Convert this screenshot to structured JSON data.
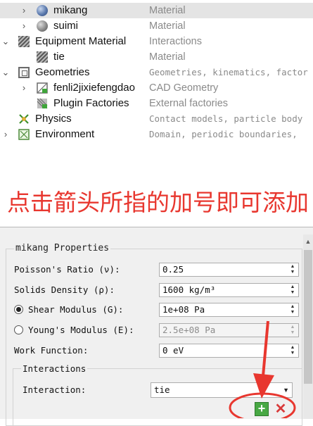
{
  "tree": {
    "items": [
      {
        "label": "mikang",
        "description": "Material",
        "icon": "material-ball-icon"
      },
      {
        "label": "suimi",
        "description": "Material",
        "icon": "material-ball-icon"
      },
      {
        "label": "Equipment Material",
        "description": "Interactions",
        "icon": "hatch-icon"
      },
      {
        "label": "tie",
        "description": "Material",
        "icon": "hatch-icon"
      },
      {
        "label": "Geometries",
        "description": "Geometries, kinematics, factor",
        "icon": "geometry-icon"
      },
      {
        "label": "fenli2jixiefengdao",
        "description": "CAD Geometry",
        "icon": "cad-geometry-icon"
      },
      {
        "label": "Plugin Factories",
        "description": "External factories",
        "icon": "plugin-factory-icon"
      },
      {
        "label": "Physics",
        "description": "Contact models, particle body",
        "icon": "physics-icon"
      },
      {
        "label": "Environment",
        "description": "Domain, periodic boundaries,",
        "icon": "environment-icon"
      }
    ]
  },
  "annotation": {
    "text": "点击箭头所指的加号即可添加",
    "color": "#e8372f"
  },
  "properties": {
    "title": "mikang Properties",
    "poisson_label": "Poisson's Ratio (ν):",
    "poisson_value": "0.25",
    "density_label": "Solids Density (ρ):",
    "density_value": "1600 kg/m³",
    "shear_label": "Shear Modulus (G):",
    "shear_value": "1e+08 Pa",
    "shear_selected": true,
    "young_label": "Young's Modulus (E):",
    "young_value": "2.5e+08 Pa",
    "work_label": "Work Function:",
    "work_value": "0 eV",
    "interactions_title": "Interactions",
    "interaction_label": "Interaction:",
    "interaction_value": "tie",
    "add_button_glyph": "+",
    "remove_button_glyph": "✕"
  },
  "colors": {
    "annotation_red": "#e8372f",
    "add_green": "#48a844",
    "remove_red": "#d83a3a",
    "selection_gray": "#e4e4e4"
  }
}
